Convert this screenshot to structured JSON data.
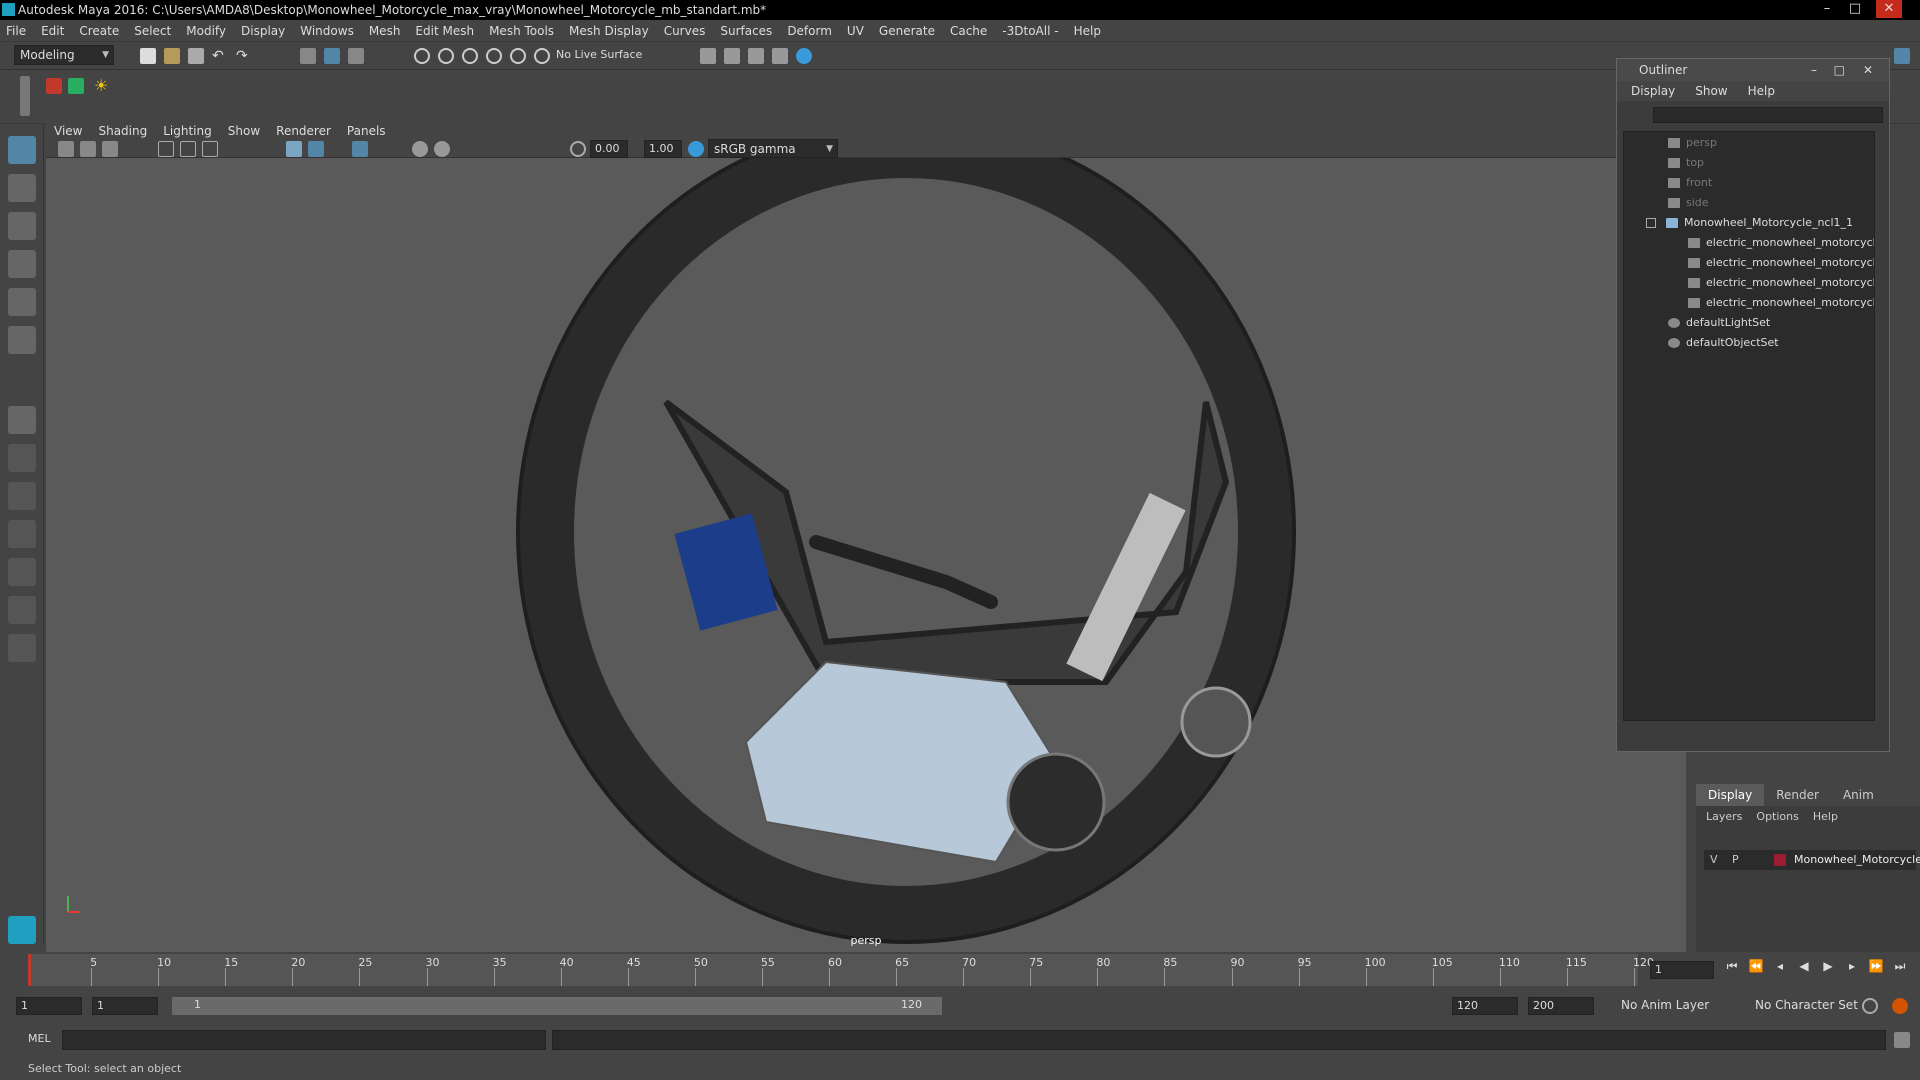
{
  "window": {
    "title": "Autodesk Maya 2016: C:\\Users\\AMDA8\\Desktop\\Monowheel_Motorcycle_max_vray\\Monowheel_Motorcycle_mb_standart.mb*",
    "minimize": "–",
    "maximize": "□",
    "close": "✕"
  },
  "menubar": [
    "File",
    "Edit",
    "Create",
    "Select",
    "Modify",
    "Display",
    "Windows",
    "Mesh",
    "Edit Mesh",
    "Mesh Tools",
    "Mesh Display",
    "Curves",
    "Surfaces",
    "Deform",
    "UV",
    "Generate",
    "Cache",
    "-3DtoAll -",
    "Help"
  ],
  "shelf": {
    "mode": "Modeling",
    "live_surface": "No Live Surface"
  },
  "viewport": {
    "menus": [
      "View",
      "Shading",
      "Lighting",
      "Show",
      "Renderer",
      "Panels"
    ],
    "exposure": "0.00",
    "gamma": "1.00",
    "color_space": "sRGB gamma",
    "camera_label": "persp"
  },
  "outliner": {
    "title": "Outliner",
    "menus": [
      "Display",
      "Show",
      "Help"
    ],
    "items": [
      {
        "label": "persp",
        "dim": true
      },
      {
        "label": "top",
        "dim": true
      },
      {
        "label": "front",
        "dim": true
      },
      {
        "label": "side",
        "dim": true
      },
      {
        "label": "Monowheel_Motorcycle_ncl1_1",
        "dim": false
      },
      {
        "label": "electric_monowheel_motorcycle",
        "dim": false
      },
      {
        "label": "electric_monowheel_motorcycle",
        "dim": false
      },
      {
        "label": "electric_monowheel_motorcycle",
        "dim": false
      },
      {
        "label": "electric_monowheel_motorcycle",
        "dim": false
      },
      {
        "label": "defaultLightSet",
        "dim": false
      },
      {
        "label": "defaultObjectSet",
        "dim": false
      }
    ]
  },
  "layers": {
    "tabs": [
      "Display",
      "Render",
      "Anim"
    ],
    "menus": [
      "Layers",
      "Options",
      "Help"
    ],
    "row": {
      "v": "V",
      "p": "P",
      "name": "Monowheel_Motorcycle"
    }
  },
  "timeline": {
    "ticks": [
      "5",
      "10",
      "15",
      "20",
      "25",
      "30",
      "35",
      "40",
      "45",
      "50",
      "55",
      "60",
      "65",
      "70",
      "75",
      "80",
      "85",
      "90",
      "95",
      "100",
      "105",
      "110",
      "115",
      "120"
    ],
    "current_frame": "1"
  },
  "range": {
    "start": "1",
    "start2": "1",
    "slider_start": "1",
    "slider_end": "120",
    "end": "120",
    "end2": "200",
    "anim_layer": "No Anim Layer",
    "char_set": "No Character Set"
  },
  "cmdline": {
    "label": "MEL"
  },
  "help": {
    "text": "Select Tool: select an object"
  },
  "colors": {
    "accent": "#5285a6",
    "brand": "#1fa0c0",
    "layer_color": "#9b1d33"
  }
}
